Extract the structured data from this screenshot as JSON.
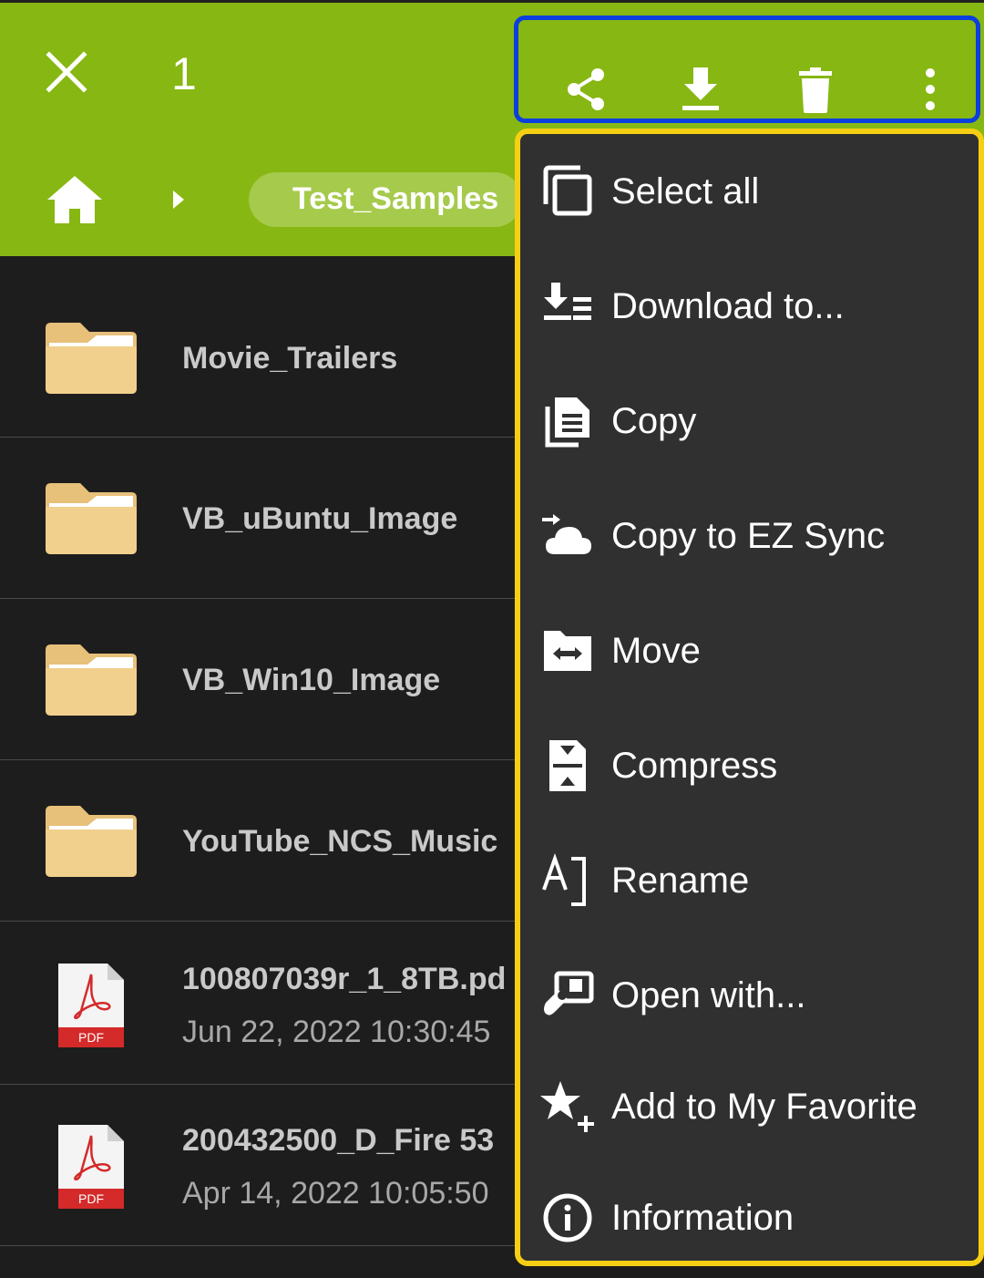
{
  "header": {
    "selected_count": "1",
    "breadcrumb_folder": "Test_Samples"
  },
  "action_icons": [
    "share-icon",
    "download-icon",
    "delete-icon",
    "more-vert-icon"
  ],
  "files": [
    {
      "name": "Movie_Trailers",
      "type": "folder"
    },
    {
      "name": "VB_uBuntu_Image",
      "type": "folder"
    },
    {
      "name": "VB_Win10_Image",
      "type": "folder"
    },
    {
      "name": "YouTube_NCS_Music",
      "type": "folder"
    },
    {
      "name": "100807039r_1_8TB.pd",
      "date": "Jun 22, 2022 10:30:45",
      "type": "pdf",
      "badge": "PDF"
    },
    {
      "name": "200432500_D_Fire 53",
      "date": "Apr 14, 2022 10:05:50",
      "type": "pdf",
      "badge": "PDF"
    }
  ],
  "menu": {
    "items": [
      {
        "label": "Select all",
        "icon": "select-all-icon"
      },
      {
        "label": "Download to...",
        "icon": "download-to-icon"
      },
      {
        "label": "Copy",
        "icon": "copy-icon"
      },
      {
        "label": "Copy to EZ Sync",
        "icon": "cloud-sync-icon"
      },
      {
        "label": "Move",
        "icon": "move-icon"
      },
      {
        "label": "Compress",
        "icon": "compress-icon"
      },
      {
        "label": "Rename",
        "icon": "rename-icon"
      },
      {
        "label": "Open with...",
        "icon": "open-with-icon"
      },
      {
        "label": "Add to My Favorite",
        "icon": "favorite-add-icon"
      },
      {
        "label": "Information",
        "icon": "info-icon"
      }
    ]
  },
  "colors": {
    "appbar": "#87b712",
    "highlight_actions": "#0b3fde",
    "highlight_menu": "#f6cf14",
    "menu_bg": "#303030",
    "list_bg": "#1d1d1d"
  }
}
